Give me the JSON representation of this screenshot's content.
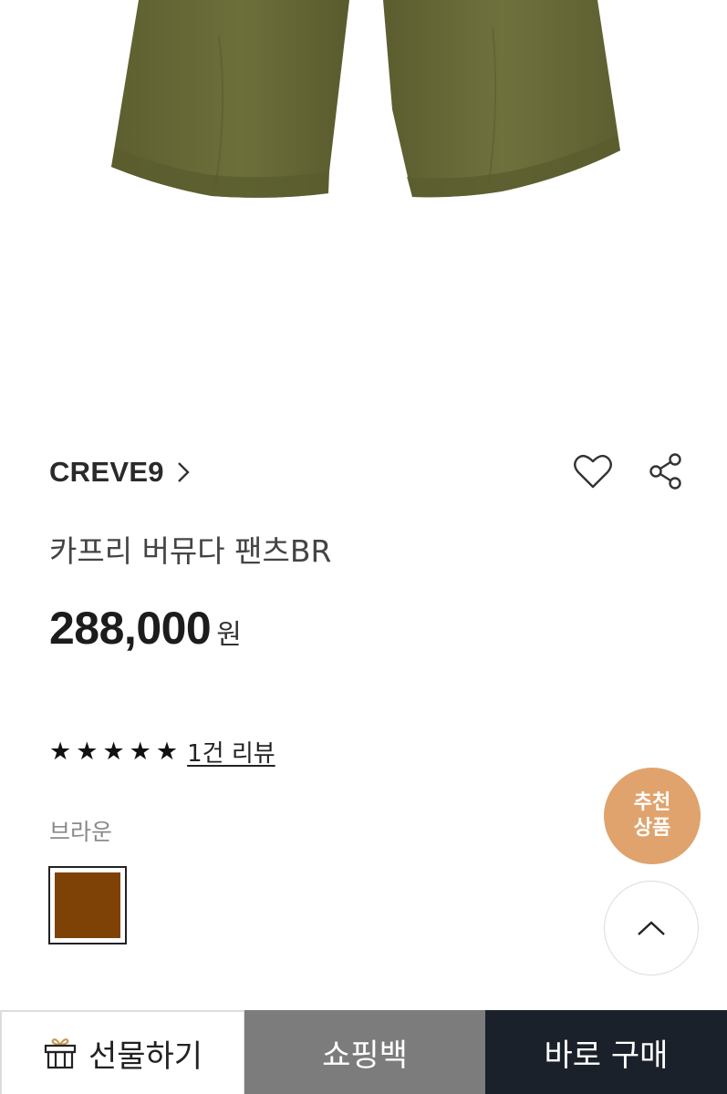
{
  "product": {
    "brand": "CREVE9",
    "name": "카프리 버뮤다 팬츠BR",
    "price": "288,000",
    "price_unit": "원",
    "rating_stars": 5,
    "review_link": "1건 리뷰",
    "color_label": "브라운",
    "color_swatch": "#7e4106",
    "image_color": "#6b6c3a"
  },
  "floating": {
    "recommend_line1": "추천",
    "recommend_line2": "상품"
  },
  "bottom_bar": {
    "gift_label": "선물하기",
    "bag_label": "쇼핑백",
    "buy_label": "바로 구매"
  }
}
